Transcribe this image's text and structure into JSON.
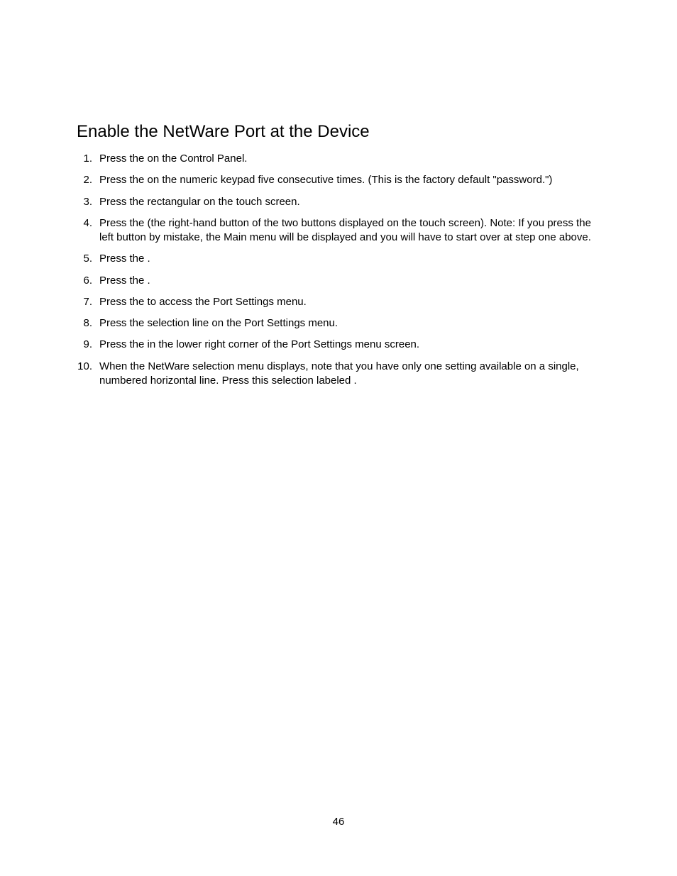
{
  "title": "Enable the NetWare Port at the Device",
  "items": [
    {
      "num": "1.",
      "text": "Press the                                 on the Control Panel."
    },
    {
      "num": "2.",
      "text": "Press the               on the numeric keypad five consecutive times.  (This is the factory default \"password.\")"
    },
    {
      "num": "3.",
      "text": "Press the rectangular                             on the touch screen."
    },
    {
      "num": "4.",
      "text": "Press the                                        (the right-hand button of the two buttons displayed on the touch screen).  Note:  If you press the left button by mistake, the Main menu will be displayed and you will have to start over at step one above."
    },
    {
      "num": "5.",
      "text": "Press the                                       ."
    },
    {
      "num": "6.",
      "text": "Press the                                       ."
    },
    {
      "num": "7.",
      "text": "Press the                                   to access the Port Settings menu."
    },
    {
      "num": "8.",
      "text": "Press the                 selection line on the Port Settings menu."
    },
    {
      "num": "9.",
      "text": "Press the                                        in the lower right corner of the Port Settings menu screen."
    },
    {
      "num": "10.",
      "text": "When the NetWare selection menu displays, note that you have only one setting available on a single, numbered horizontal line.  Press this selection labeled                       ."
    }
  ],
  "pageNumber": "46"
}
